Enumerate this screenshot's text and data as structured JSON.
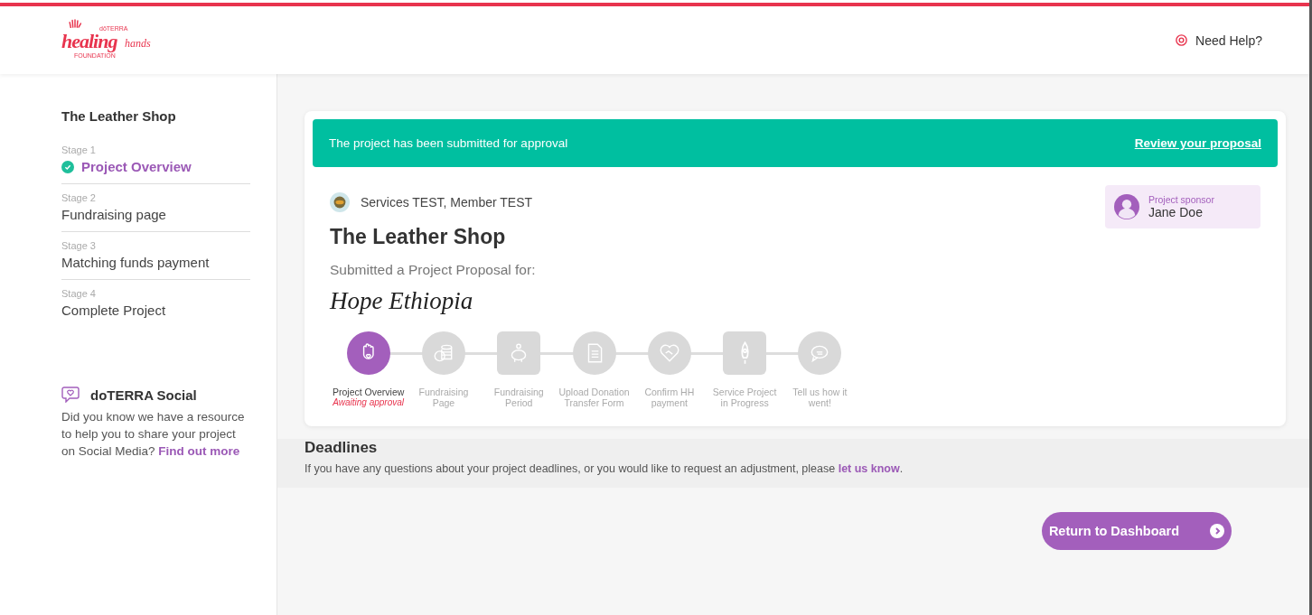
{
  "header": {
    "logo": {
      "brand": "dōTERRA",
      "word_1": "healing",
      "word_2": "hands",
      "tagline": "FOUNDATION"
    },
    "help": "Need Help?"
  },
  "sidebar": {
    "title": "The Leather Shop",
    "stages": [
      {
        "stage": "Stage 1",
        "name": "Project Overview",
        "selected": true
      },
      {
        "stage": "Stage 2",
        "name": "Fundraising page",
        "selected": false
      },
      {
        "stage": "Stage 3",
        "name": "Matching funds payment",
        "selected": false
      },
      {
        "stage": "Stage 4",
        "name": "Complete Project",
        "selected": false
      }
    ],
    "social": {
      "title": "doTERRA Social",
      "text": "Did you know we have a resource to help you to share your project on Social Media?",
      "link": "Find out more"
    }
  },
  "banner": {
    "message": "The project has been submitted for approval",
    "link": "Review your proposal"
  },
  "project": {
    "members": "Services TEST, Member TEST",
    "title": "The Leather Shop",
    "subtitle": "Submitted a Project Proposal for:",
    "charity": "Hope Ethiopia",
    "sponsor": {
      "label": "Project sponsor",
      "name": "Jane Doe"
    }
  },
  "steps": [
    {
      "label": "Project Overview",
      "status": "Awaiting approval",
      "selected": true,
      "kind": "circle"
    },
    {
      "label": "Fundraising Page",
      "selected": false,
      "kind": "circle"
    },
    {
      "label": "Fundraising Period",
      "selected": false,
      "kind": "square"
    },
    {
      "label": "Upload Donation Transfer Form",
      "selected": false,
      "kind": "circle"
    },
    {
      "label": "Confirm HH payment",
      "selected": false,
      "kind": "circle"
    },
    {
      "label": "Service Project in Progress",
      "selected": false,
      "kind": "square"
    },
    {
      "label": "Tell us how it went!",
      "selected": false,
      "kind": "circle"
    }
  ],
  "deadlines": {
    "title": "Deadlines",
    "text": "If you have any questions about your project deadlines, or you would like to request an adjustment, please",
    "link": "let us know",
    "end": "."
  },
  "return_button": "Return to Dashboard"
}
